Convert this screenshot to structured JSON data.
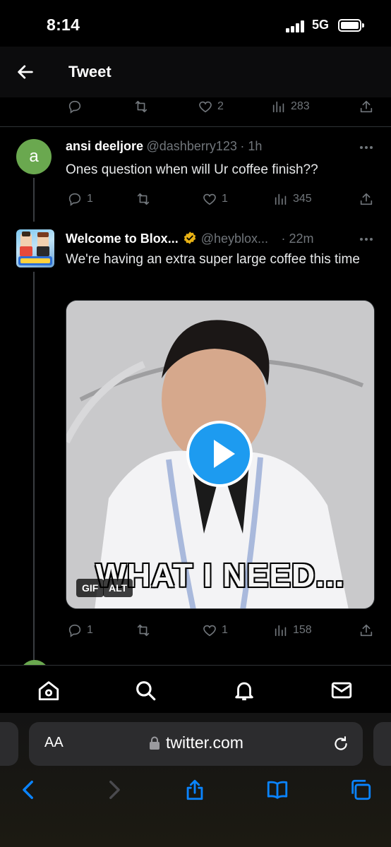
{
  "status": {
    "time": "8:14",
    "network": "5G"
  },
  "header": {
    "title": "Tweet"
  },
  "top_actions": {
    "likes": "2",
    "views": "283"
  },
  "reply1": {
    "avatar_letter": "a",
    "name": "ansi deeljore",
    "handle": "@dashberry123",
    "time": "· 1h",
    "text": "Ones question when will Ur coffee finish??",
    "replies": "1",
    "likes": "1",
    "views": "345"
  },
  "reply2": {
    "name": "Welcome to Blox...",
    "handle": "@heyblox...",
    "time": "· 22m",
    "text": "We're having an extra super large coffee this time",
    "media_caption": "WHAT I NEED...",
    "gif_badge": "GIF",
    "alt_badge": "ALT",
    "replies": "1",
    "likes": "1",
    "views": "158"
  },
  "browser": {
    "aa_label": "AA",
    "url": "twitter.com"
  },
  "colors": {
    "accent": "#1d9bf0",
    "muted": "#71767b",
    "verified": "#e8b215"
  }
}
